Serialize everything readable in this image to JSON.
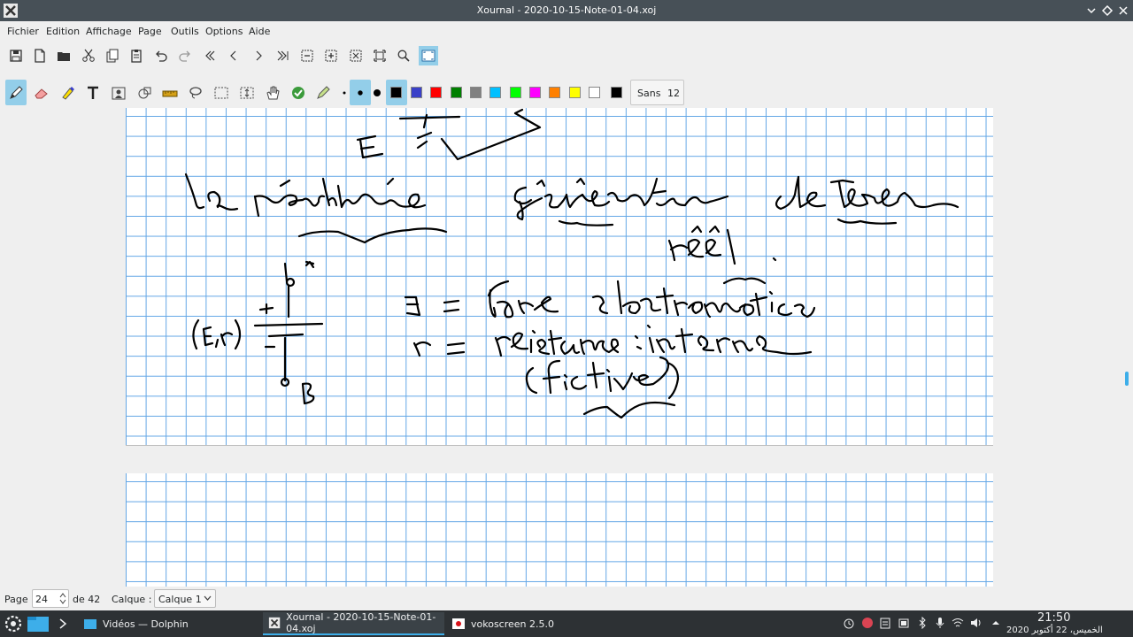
{
  "window": {
    "title": "Xournal - 2020-10-15-Note-01-04.xoj"
  },
  "menu": [
    "Fichier",
    "Edition",
    "Affichage",
    "Page",
    "Outils",
    "Options",
    "Aide"
  ],
  "toolbar": {
    "font_name": "Sans",
    "font_size": "12",
    "colors": [
      "#000000",
      "#3a40c8",
      "#ff0000",
      "#008000",
      "#808080",
      "#00c0ff",
      "#00ff00",
      "#ff00ff",
      "#ff8000",
      "#ffff00",
      "#ffffff",
      "#000000"
    ]
  },
  "status": {
    "page_label": "Page",
    "page_value": "24",
    "of_label": "de 42",
    "layer_label": "Calque :",
    "layer_value": "Calque 1"
  },
  "taskbar": {
    "tasks": [
      "Vidéos — Dolphin",
      "Xournal - 2020-10-15-Note-01-04.xoj",
      "vokoscreen 2.5.0"
    ],
    "time": "21:50",
    "date": "الخميس، 22 أكتوبر 2020"
  },
  "accent": "#3daee9"
}
